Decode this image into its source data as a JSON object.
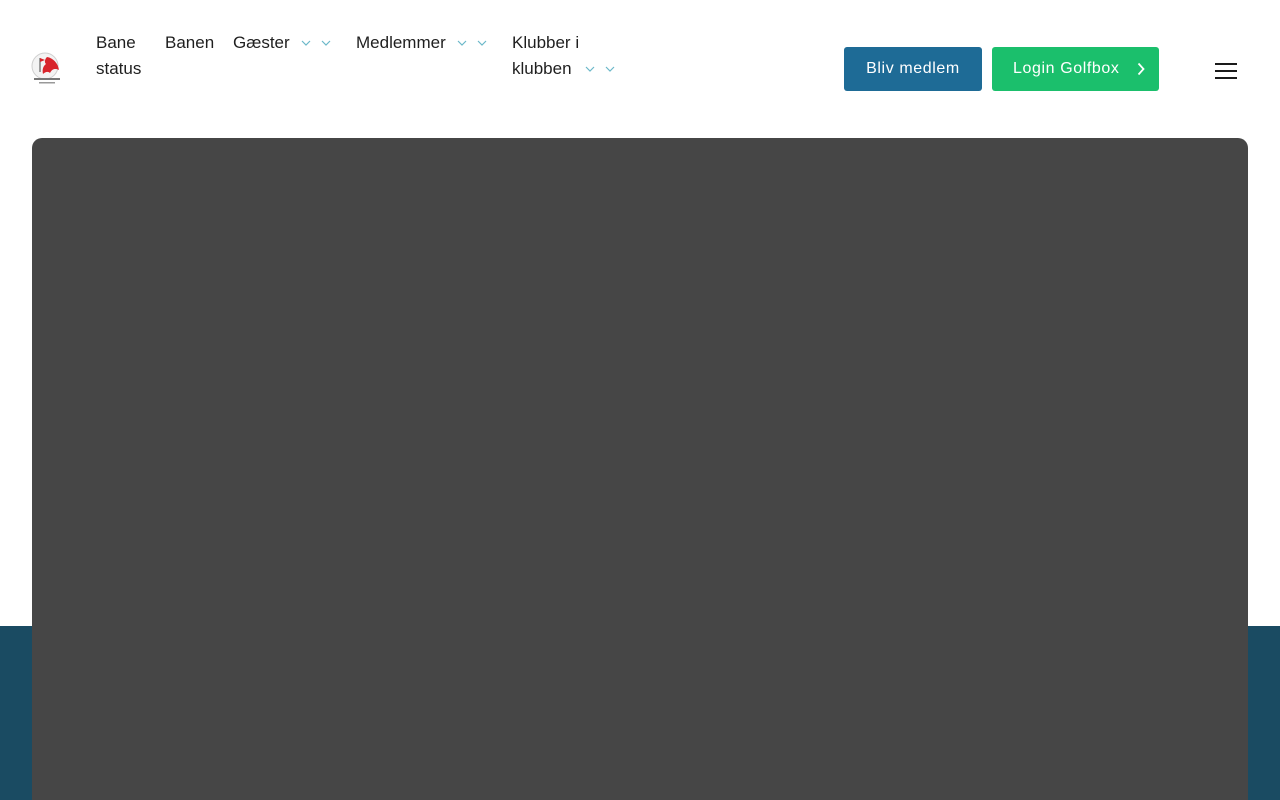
{
  "header": {
    "logo_icon": "golf-club-crest-icon",
    "nav": {
      "bane_status": "Bane status",
      "banen": "Banen",
      "gaester": "Gæster",
      "medlemmer": "Medlemmer",
      "klubber": "Klubber i klubben"
    },
    "buttons": {
      "bliv_medlem": "Bliv medlem",
      "login_golfbox": "Login Golfbox"
    },
    "menu_icon": "hamburger-menu-icon"
  },
  "colors": {
    "primary_blue": "#1e6b96",
    "accent_green": "#1bbf6c",
    "chevron": "#6bb8c9",
    "hero_placeholder": "#464646",
    "band": "#1a4b62"
  }
}
